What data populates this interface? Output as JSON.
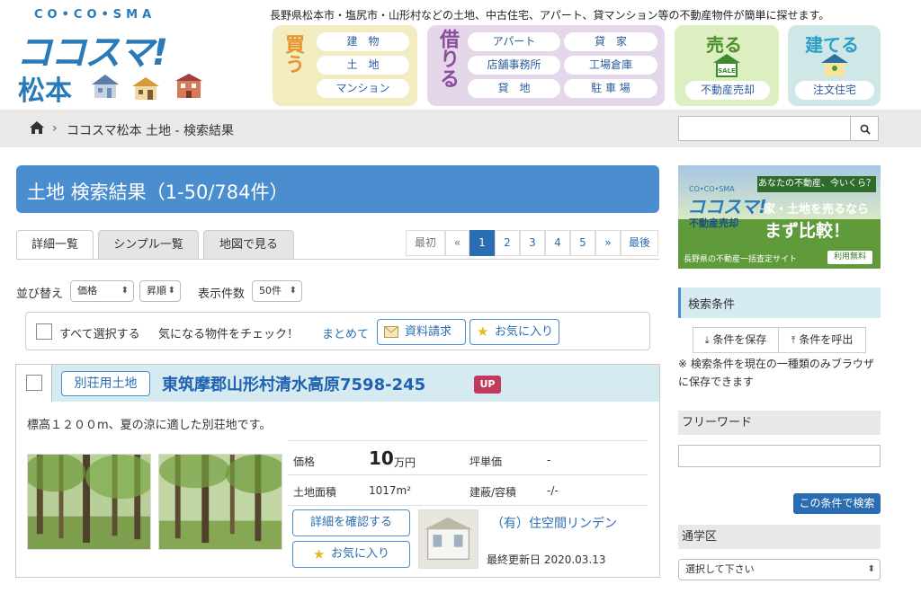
{
  "header": {
    "logo_small": "CO•CO•SMA",
    "logo_main": "ココスマ!",
    "logo_city": "松本",
    "tagline": "長野県松本市・塩尻市・山形村などの土地、中古住宅、アパート、貸マンション等の不動産物件が簡単に探せます。",
    "buy": {
      "title": "買う",
      "items": [
        "建　物",
        "土　地",
        "マンション"
      ]
    },
    "rent": {
      "title": "借りる",
      "items": [
        "アパート",
        "貸　家",
        "店舗事務所",
        "工場倉庫",
        "貸　地",
        "駐 車 場"
      ]
    },
    "sell": {
      "title": "売る",
      "badge": "SALE",
      "button": "不動産売却"
    },
    "build": {
      "title": "建てる",
      "button": "注文住宅"
    }
  },
  "breadcrumb": {
    "sep": "›",
    "current": "ココスマ松本 土地 - 検索結果"
  },
  "search": {
    "placeholder": ""
  },
  "main": {
    "title": "土地 検索結果（1-50/784件）",
    "tabs": [
      "詳細一覧",
      "シンプル一覧",
      "地図で見る"
    ],
    "pagination": [
      "最初",
      "«",
      "1",
      "2",
      "3",
      "4",
      "5",
      "»",
      "最後"
    ],
    "sort_label": "並び替え",
    "sort_value": "価格",
    "order_value": "昇順",
    "count_label": "表示件数",
    "count_value": "50件",
    "select_all": "すべて選択する",
    "check_prompt": "気になる物件をチェック！",
    "bulk_label": "まとめて",
    "request_btn": "資料請求",
    "favorite_btn": "お気に入り"
  },
  "listing": {
    "category": "別荘用土地",
    "title": "東筑摩郡山形村清水高原7598-245",
    "badge": "UP",
    "description": "標高１２００m、夏の涼に適した別荘地です。",
    "price_label": "価格",
    "price_value": "10",
    "price_unit": "万円",
    "tsubo_label": "坪単価",
    "tsubo_value": "-",
    "area_label": "土地面積",
    "area_value": "1017m²",
    "ratio_label": "建蔽/容積",
    "ratio_value": "-/-",
    "detail_btn": "詳細を確認する",
    "fav_btn": "お気に入り",
    "company": "（有）住空間リンデン",
    "updated": "最終更新日 2020.03.13"
  },
  "sidebar": {
    "banner": {
      "small": "CO•CO•SMA",
      "tag": "あなたの不動産、今いくら？",
      "logo": "ココスマ!",
      "sub": "不動産売却",
      "line1": "家・土地を売るなら",
      "line2": "まず比較！",
      "foot": "長野県の不動産一括査定サイト",
      "free": "利用無料"
    },
    "cond_title": "検索条件",
    "save_btn": "条件を保存",
    "load_btn": "条件を呼出",
    "note": "※ 検索条件を現在の一種類のみブラウザに保存できます",
    "freeword_title": "フリーワード",
    "search_btn": "この条件で検索",
    "school_title": "通学区",
    "school_value": "選択して下さい"
  },
  "colors": {
    "accent": "#4b8ecf",
    "link": "#2a6db0",
    "badge": "#c23a5b"
  }
}
